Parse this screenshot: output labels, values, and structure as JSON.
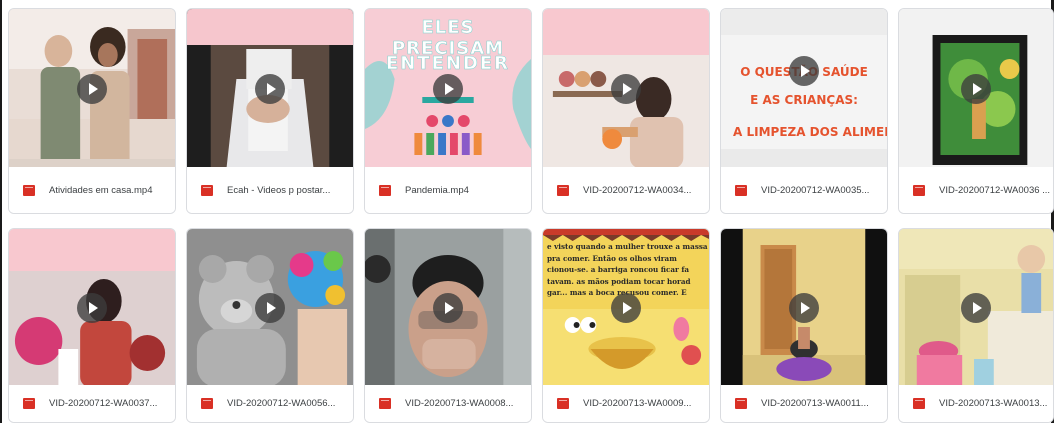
{
  "files": [
    {
      "name": "Atividades em casa.mp4"
    },
    {
      "name": "Ecah - Videos p postar..."
    },
    {
      "name": "Pandemia.mp4"
    },
    {
      "name": "VID-20200712-WA0034..."
    },
    {
      "name": "VID-20200712-WA0035..."
    },
    {
      "name": "VID-20200712-WA0036 ..."
    },
    {
      "name": "VID-20200712-WA0037..."
    },
    {
      "name": "VID-20200712-WA0056..."
    },
    {
      "name": "VID-20200713-WA0008..."
    },
    {
      "name": "VID-20200713-WA0009..."
    },
    {
      "name": "VID-20200713-WA0011..."
    },
    {
      "name": "VID-20200713-WA0013..."
    }
  ],
  "thumb_text": {
    "pandemia_line1": "ELES PRECISAM",
    "pandemia_line2": "ENTENDER",
    "wa0035_line1": "O QUESTÃO SAÚDE",
    "wa0035_line2": "E AS CRIANÇAS:",
    "wa0035_line3": "A LIMPEZA DOS ALIMEN",
    "wa0009_line1": "e visto quando a mulher trouxe a massa",
    "wa0009_line2": "pra comer. Então os olhos viram",
    "wa0009_line3": "cionou-se. a barriga roncou ficar fa",
    "wa0009_line4": "tavam. as mãos podiam tocar horad",
    "wa0009_line5": "gar... mas a boca recusou comer. E"
  },
  "colors": {
    "file_icon": "#d93025",
    "play_bg": "#3c3c3c",
    "card_border": "#dadce0",
    "pink_band": "#f8c8cf"
  },
  "icons": {
    "play": "play-icon",
    "file": "video-file-icon"
  }
}
